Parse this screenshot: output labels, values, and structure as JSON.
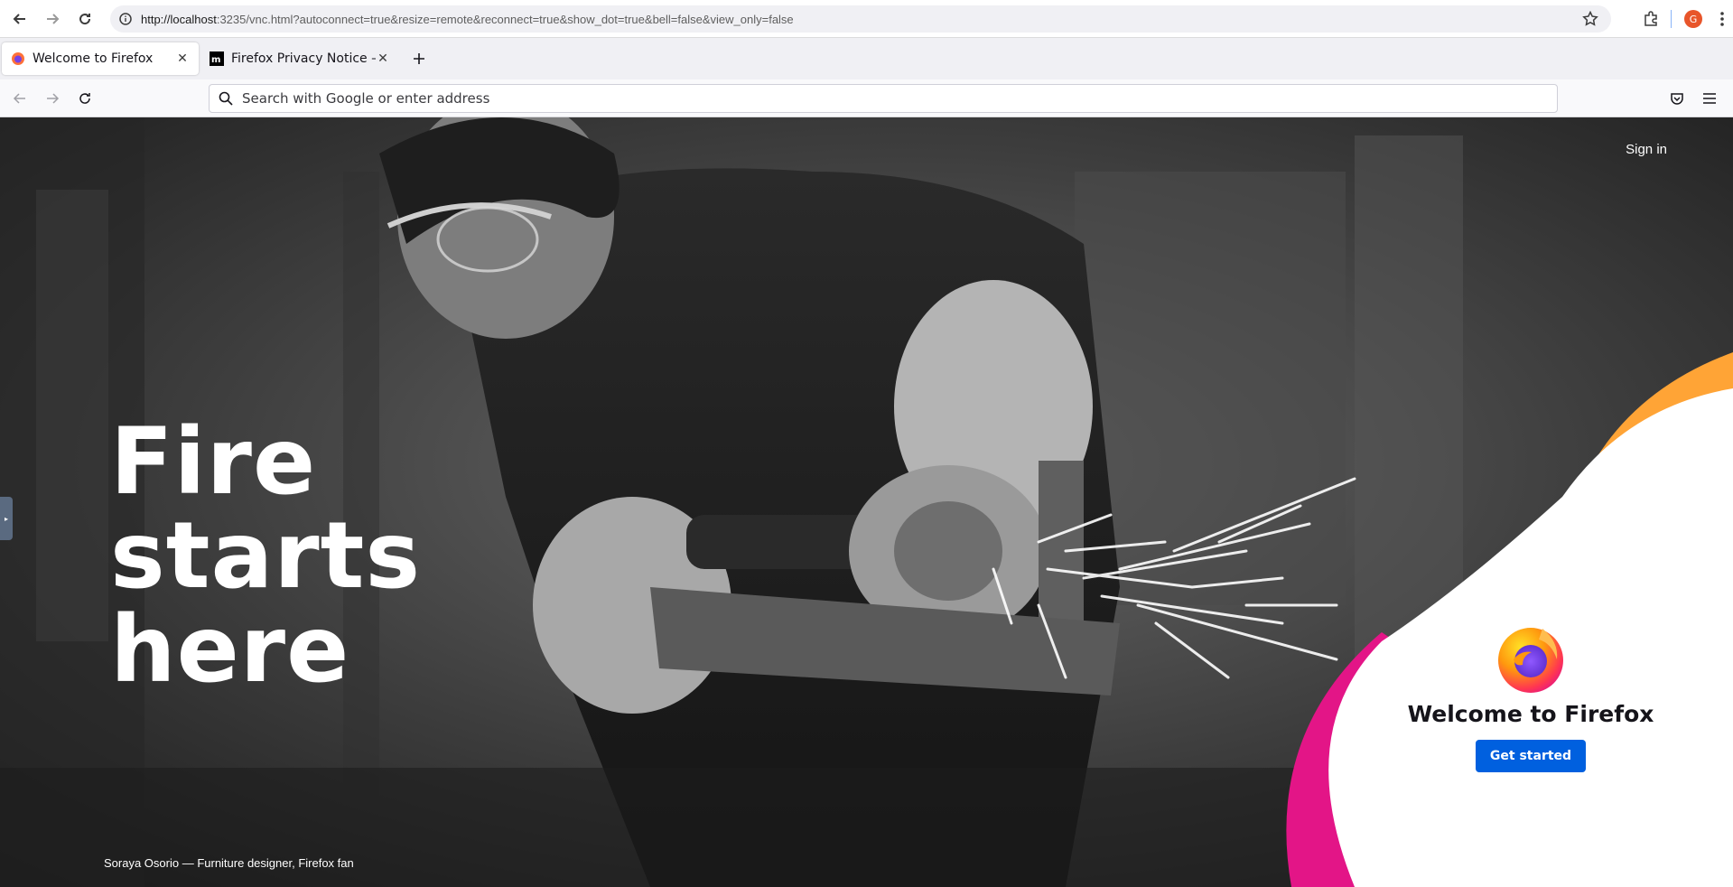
{
  "host": {
    "url_host": "http://localhost",
    "url_rest": ":3235/vnc.html?autoconnect=true&resize=remote&reconnect=true&show_dot=true&bell=false&view_only=false",
    "avatar_letter": "G"
  },
  "tabs": [
    {
      "label": "Welcome to Firefox",
      "active": true
    },
    {
      "label": "Firefox Privacy Notice — ",
      "active": false
    }
  ],
  "urlbar": {
    "placeholder": "Search with Google or enter address"
  },
  "page": {
    "sign_in": "Sign in",
    "hero_lines": [
      "Fire",
      "starts",
      "here"
    ],
    "credit": "Soraya Osorio — Furniture designer, Firefox fan",
    "welcome_title": "Welcome to Firefox",
    "get_started": "Get started"
  },
  "colors": {
    "accent": "#0060df",
    "pink": "#e31587",
    "orange": "#ffa436"
  },
  "icons": [
    "back-icon",
    "forward-icon",
    "reload-icon",
    "info-icon",
    "star-icon",
    "extensions-icon",
    "kebab-icon",
    "firefox-icon",
    "mozilla-icon",
    "plus-icon",
    "search-icon",
    "pocket-icon",
    "hamburger-icon"
  ]
}
